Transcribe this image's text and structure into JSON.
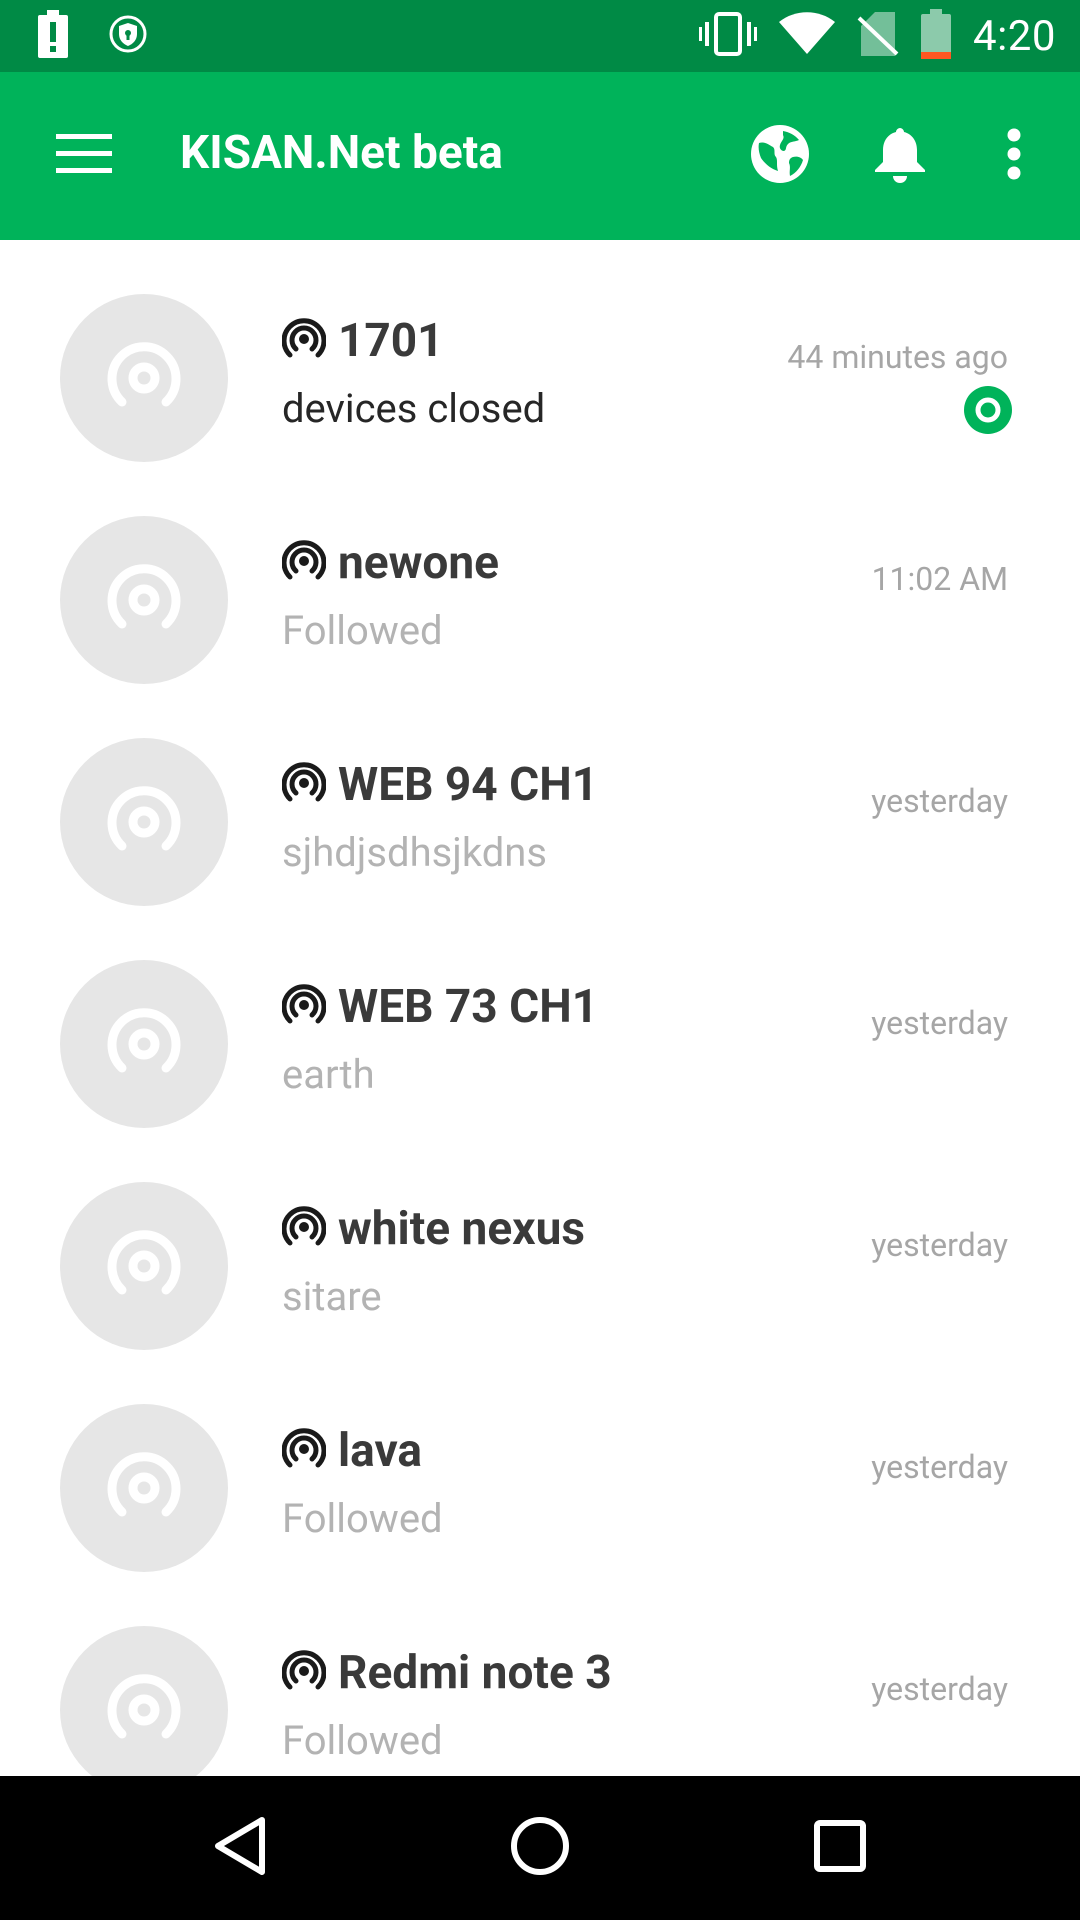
{
  "status_bar": {
    "time": "4:20",
    "icons": [
      "battery-alert-icon",
      "shield-icon",
      "vibrate-icon",
      "wifi-icon",
      "no-sim-icon",
      "battery-icon"
    ]
  },
  "app_bar": {
    "title": "KISAN.Net beta",
    "actions": [
      "globe-icon",
      "bell-icon",
      "more-vert-icon"
    ]
  },
  "channels": [
    {
      "name": "1701",
      "subtitle": "devices closed",
      "time": "44 minutes ago",
      "unread": true
    },
    {
      "name": "newone",
      "subtitle": "Followed",
      "time": "11:02 AM",
      "unread": false
    },
    {
      "name": "WEB 94 CH1",
      "subtitle": "sjhdjsdhsjkdns",
      "time": "yesterday",
      "unread": false
    },
    {
      "name": "WEB 73 CH1",
      "subtitle": "earth",
      "time": "yesterday",
      "unread": false
    },
    {
      "name": "white nexus",
      "subtitle": "sitare",
      "time": "yesterday",
      "unread": false
    },
    {
      "name": "lava",
      "subtitle": "Followed",
      "time": "yesterday",
      "unread": false
    },
    {
      "name": "Redmi note 3",
      "subtitle": "Followed",
      "time": "yesterday",
      "unread": false
    }
  ],
  "colors": {
    "status_bar": "#008a45",
    "app_bar": "#00b35a",
    "accent": "#00b35a",
    "avatar_bg": "#e6e6e6"
  },
  "nav_bar": [
    "back-icon",
    "home-icon",
    "recents-icon"
  ]
}
